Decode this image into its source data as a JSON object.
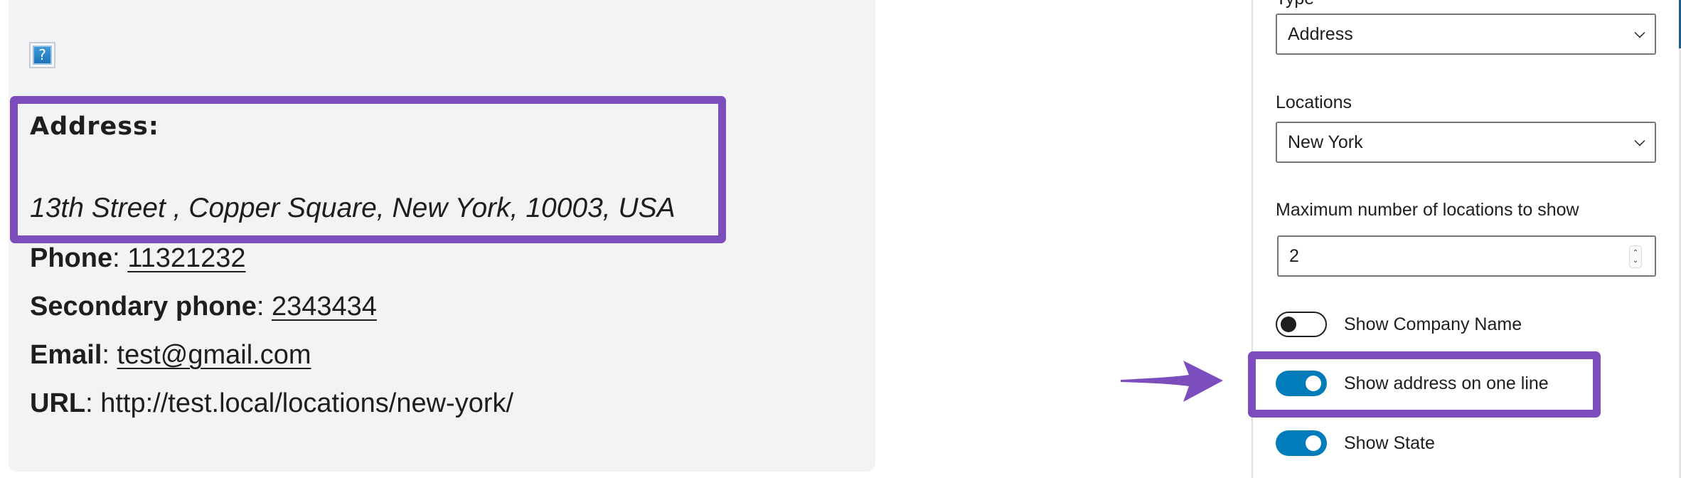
{
  "preview": {
    "help_icon_glyph": "?",
    "address": {
      "label": "Address:",
      "line": "13th Street , Copper Square, New York, 10003, USA"
    },
    "phone": {
      "label": "Phone",
      "sep": ": ",
      "value": "11321232"
    },
    "secondary_phone": {
      "label": "Secondary phone",
      "sep": ": ",
      "value": "2343434"
    },
    "email": {
      "label": "Email",
      "sep": ": ",
      "value": "test@gmail.com"
    },
    "url": {
      "label": "URL",
      "sep": ": ",
      "value": "http://test.local/locations/new-york/"
    }
  },
  "settings": {
    "type": {
      "label": "Type",
      "value": "Address"
    },
    "locations": {
      "label": "Locations",
      "value": "New York"
    },
    "max_locations": {
      "label": "Maximum number of locations to show",
      "value": "2",
      "spin_up": "⌃",
      "spin_down": "⌄"
    },
    "toggles": [
      {
        "label": "Show Company Name",
        "checked": false
      },
      {
        "label": "Show address on one line",
        "checked": true
      },
      {
        "label": "Show State",
        "checked": true
      }
    ]
  },
  "annotation": {
    "highlight_color": "#7c4dbc",
    "toggle_on_color": "#007cba"
  }
}
